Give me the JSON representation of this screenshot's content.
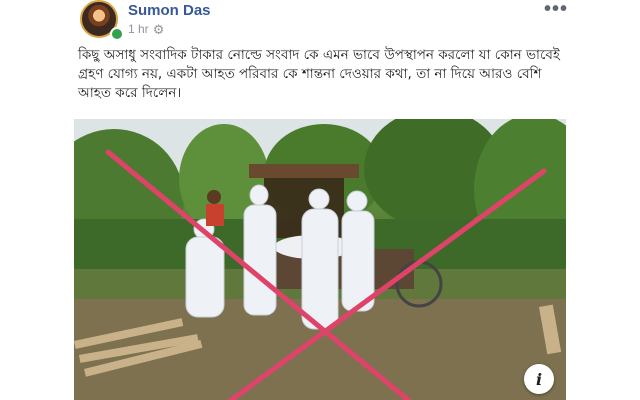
{
  "post": {
    "author": "Sumon Das",
    "time": "1 hr",
    "privacy_icon": "gear-icon",
    "more_label": "•••",
    "body": "কিছু অসাধু সংবাদিক টাকার নোল্ডে সংবাদ কে এমন ভাবে উপস্থাপন করলো যা কোন ভাবেই গ্রহণ যোগ্য নয়, একটা আহত পরিবার কে শান্তনা দেওয়ার কথা, তা না দিয়ে আরও বেশি আহত করে দিলেন।",
    "image_overlay": {
      "mark": "red-cross-out",
      "color": "#e0436a"
    },
    "info_label": "i"
  },
  "colors": {
    "author_link": "#385898",
    "meta_text": "#90949c",
    "online_dot": "#31a24c"
  }
}
